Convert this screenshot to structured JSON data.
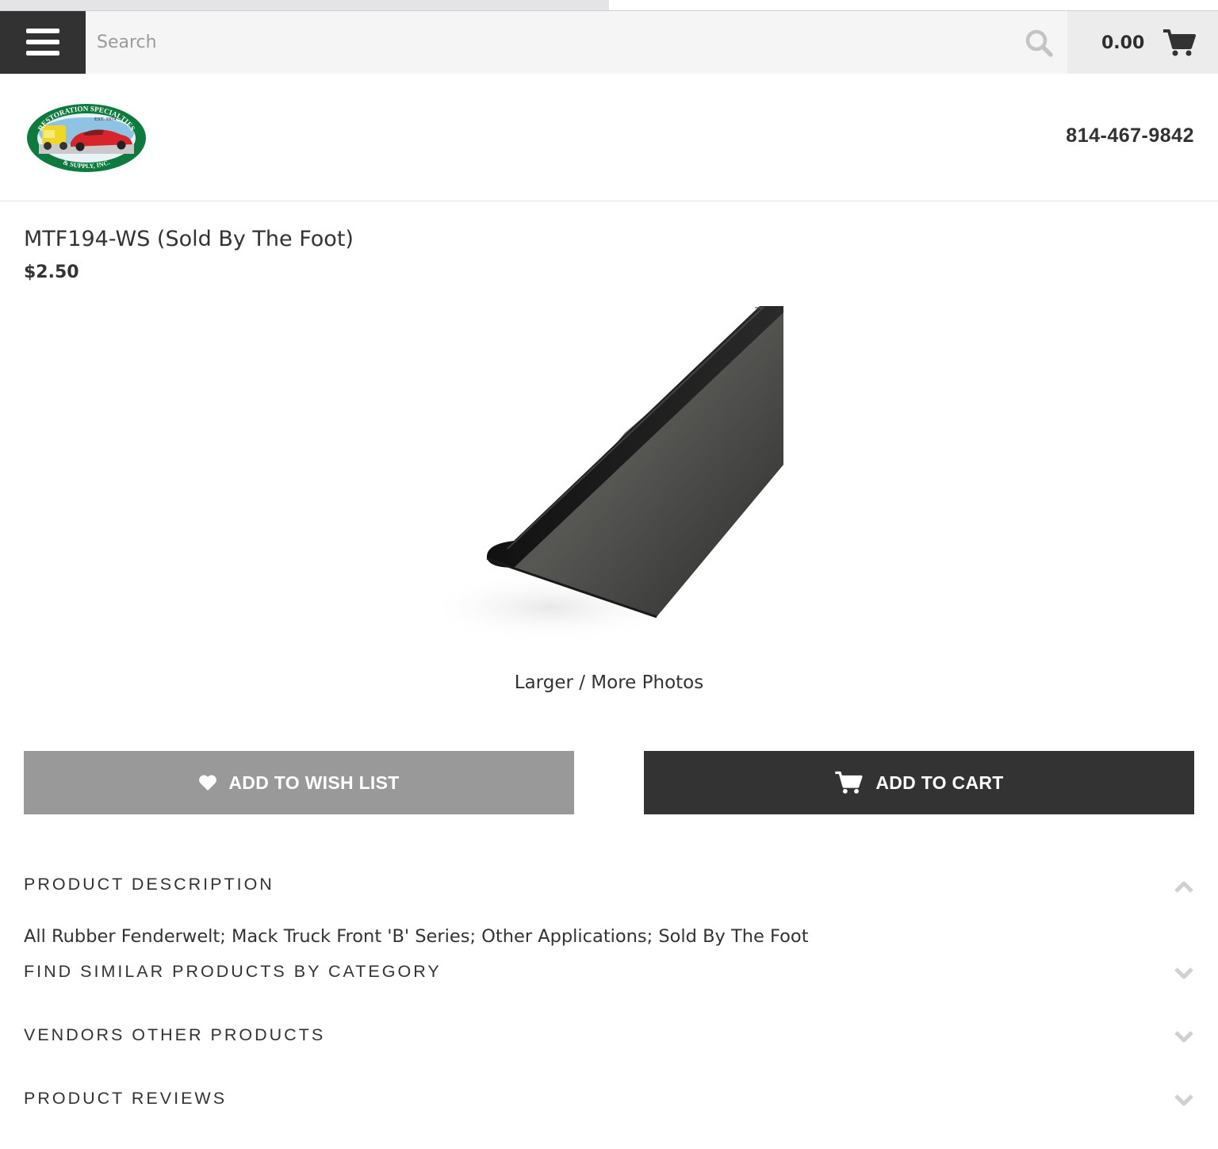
{
  "search": {
    "placeholder": "Search"
  },
  "cart": {
    "total": "0.00"
  },
  "header": {
    "phone": "814-467-9842"
  },
  "logo": {
    "top_text": "RESTORATION SPECIALTIES",
    "est_text": "EST. 1974",
    "bottom_text": "& SUPPLY, INC."
  },
  "product": {
    "title": "MTF194-WS (Sold By The Foot)",
    "price": "$2.50",
    "photos_link": "Larger / More Photos"
  },
  "actions": {
    "wish_list": "ADD TO WISH LIST",
    "add_to_cart": "ADD TO CART"
  },
  "sections": {
    "description": {
      "label": "PRODUCT DESCRIPTION",
      "text": "All Rubber Fenderwelt; Mack Truck Front 'B' Series; Other Applications; Sold By The Foot",
      "state": "expanded"
    },
    "similar": {
      "label": "FIND SIMILAR PRODUCTS BY CATEGORY",
      "state": "collapsed"
    },
    "vendors": {
      "label": "VENDORS OTHER PRODUCTS",
      "state": "collapsed"
    },
    "reviews": {
      "label": "PRODUCT REVIEWS",
      "state": "collapsed"
    }
  },
  "icons": {
    "menu": "hamburger-icon",
    "search": "search-icon",
    "cart": "cart-icon",
    "wish": "heart-icon",
    "expanded": "chevron-up-icon",
    "collapsed": "chevron-down-icon"
  },
  "colors": {
    "dark": "#333333",
    "wish_button": "#999999",
    "topbar": "#f5f5f5",
    "logo_green": "#0d7a3e",
    "logo_red": "#d8252c"
  },
  "page_loading": {
    "progress": 0.5
  }
}
